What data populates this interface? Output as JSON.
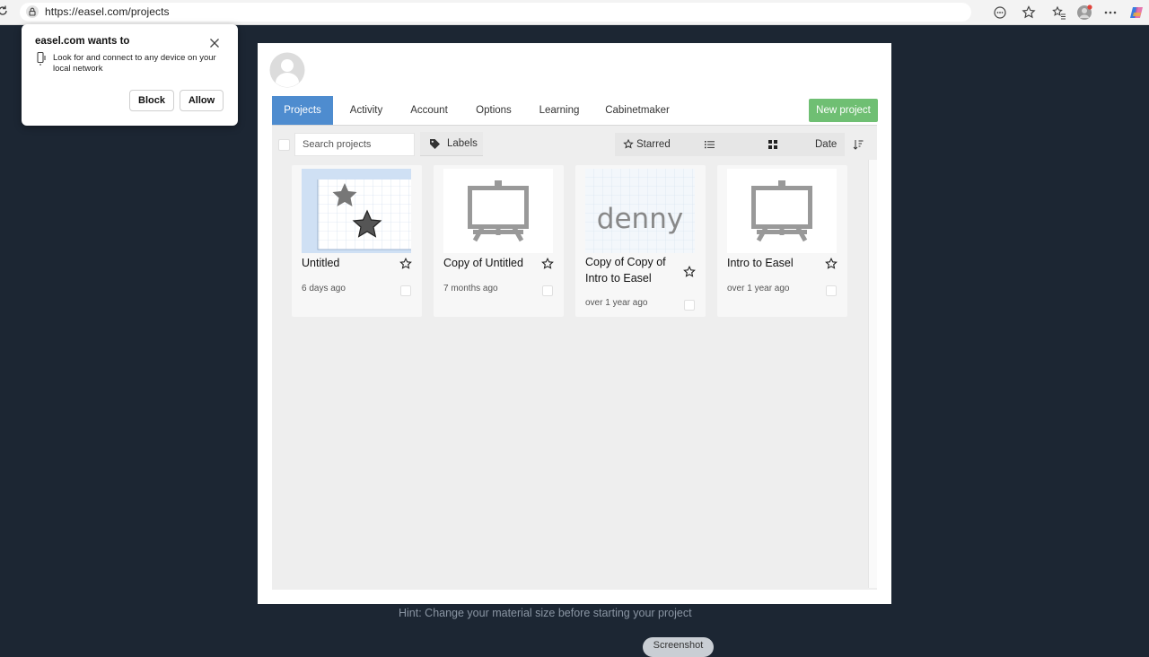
{
  "browser": {
    "url": "https://easel.com/projects"
  },
  "permission_popup": {
    "title": "easel.com wants to",
    "message": "Look for and connect to any device on your local network",
    "block_label": "Block",
    "allow_label": "Allow"
  },
  "tabs": [
    {
      "label": "Projects",
      "active": true
    },
    {
      "label": "Activity"
    },
    {
      "label": "Account"
    },
    {
      "label": "Options"
    },
    {
      "label": "Learning"
    },
    {
      "label": "Cabinetmaker"
    }
  ],
  "new_project_label": "New project",
  "toolbar": {
    "search_placeholder": "Search projects",
    "labels_label": "Labels",
    "starred_label": "Starred",
    "sort_label": "Date"
  },
  "projects": [
    {
      "title": "Untitled",
      "date": "6 days ago"
    },
    {
      "title": "Copy of Untitled",
      "date": "7 months ago"
    },
    {
      "title": "Copy of Copy of Intro to Easel",
      "date": "over 1 year ago",
      "thumb_text": "denny"
    },
    {
      "title": "Intro to Easel",
      "date": "over 1 year ago"
    }
  ],
  "hint": "Hint: Change your material size before starting your project",
  "screenshot_label": "Screenshot",
  "colors": {
    "background": "#1c2633",
    "active_tab": "#4e8ccf",
    "new_project": "#6fbf73"
  }
}
